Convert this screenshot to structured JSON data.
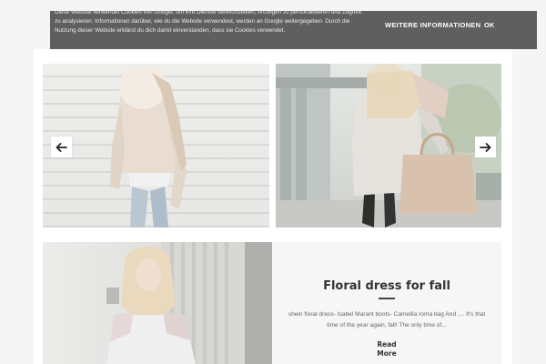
{
  "cookie_banner": {
    "text": "Diese Website verwendet Cookies von Google, um ihre Dienste bereitzustellen, Anzeigen zu personalisieren und Zugriffe zu analysieren. Informationen darüber, wie du die Website verwendest, werden an Google weitergegeben. Durch die Nutzung dieser Website erklärst du dich damit einverstanden, dass sie Cookies verwendet.",
    "more_info_label": "WEITERE INFORMATIONEN",
    "ok_label": "OK"
  },
  "slider": {
    "prev_icon": "arrow-left-icon",
    "next_icon": "arrow-right-icon"
  },
  "post": {
    "title": "Floral dress for fall",
    "excerpt": "shein floral dress- Isabel Marant boots- Camellia roma bag And .... It's that time of the year again, fall! The only time of...",
    "read_more_line1": "Read",
    "read_more_line2": "More"
  },
  "colors": {
    "page_bg": "#f5f5f5",
    "banner_bg": "#5f5f5f",
    "title_text": "#333333"
  }
}
